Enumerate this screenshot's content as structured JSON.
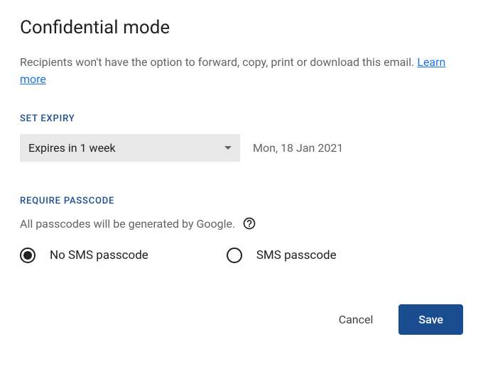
{
  "dialog": {
    "title": "Confidential mode",
    "description_prefix": "Recipients won't have the option to forward, copy, print or download this email. ",
    "learn_more": "Learn more"
  },
  "expiry": {
    "section_label": "SET EXPIRY",
    "dropdown_value": "Expires in 1 week",
    "date_display": "Mon, 18 Jan 2021"
  },
  "passcode": {
    "section_label": "REQUIRE PASSCODE",
    "description": "All passcodes will be generated by Google.",
    "options": {
      "no_sms": "No SMS passcode",
      "sms": "SMS passcode"
    }
  },
  "buttons": {
    "cancel": "Cancel",
    "save": "Save"
  }
}
